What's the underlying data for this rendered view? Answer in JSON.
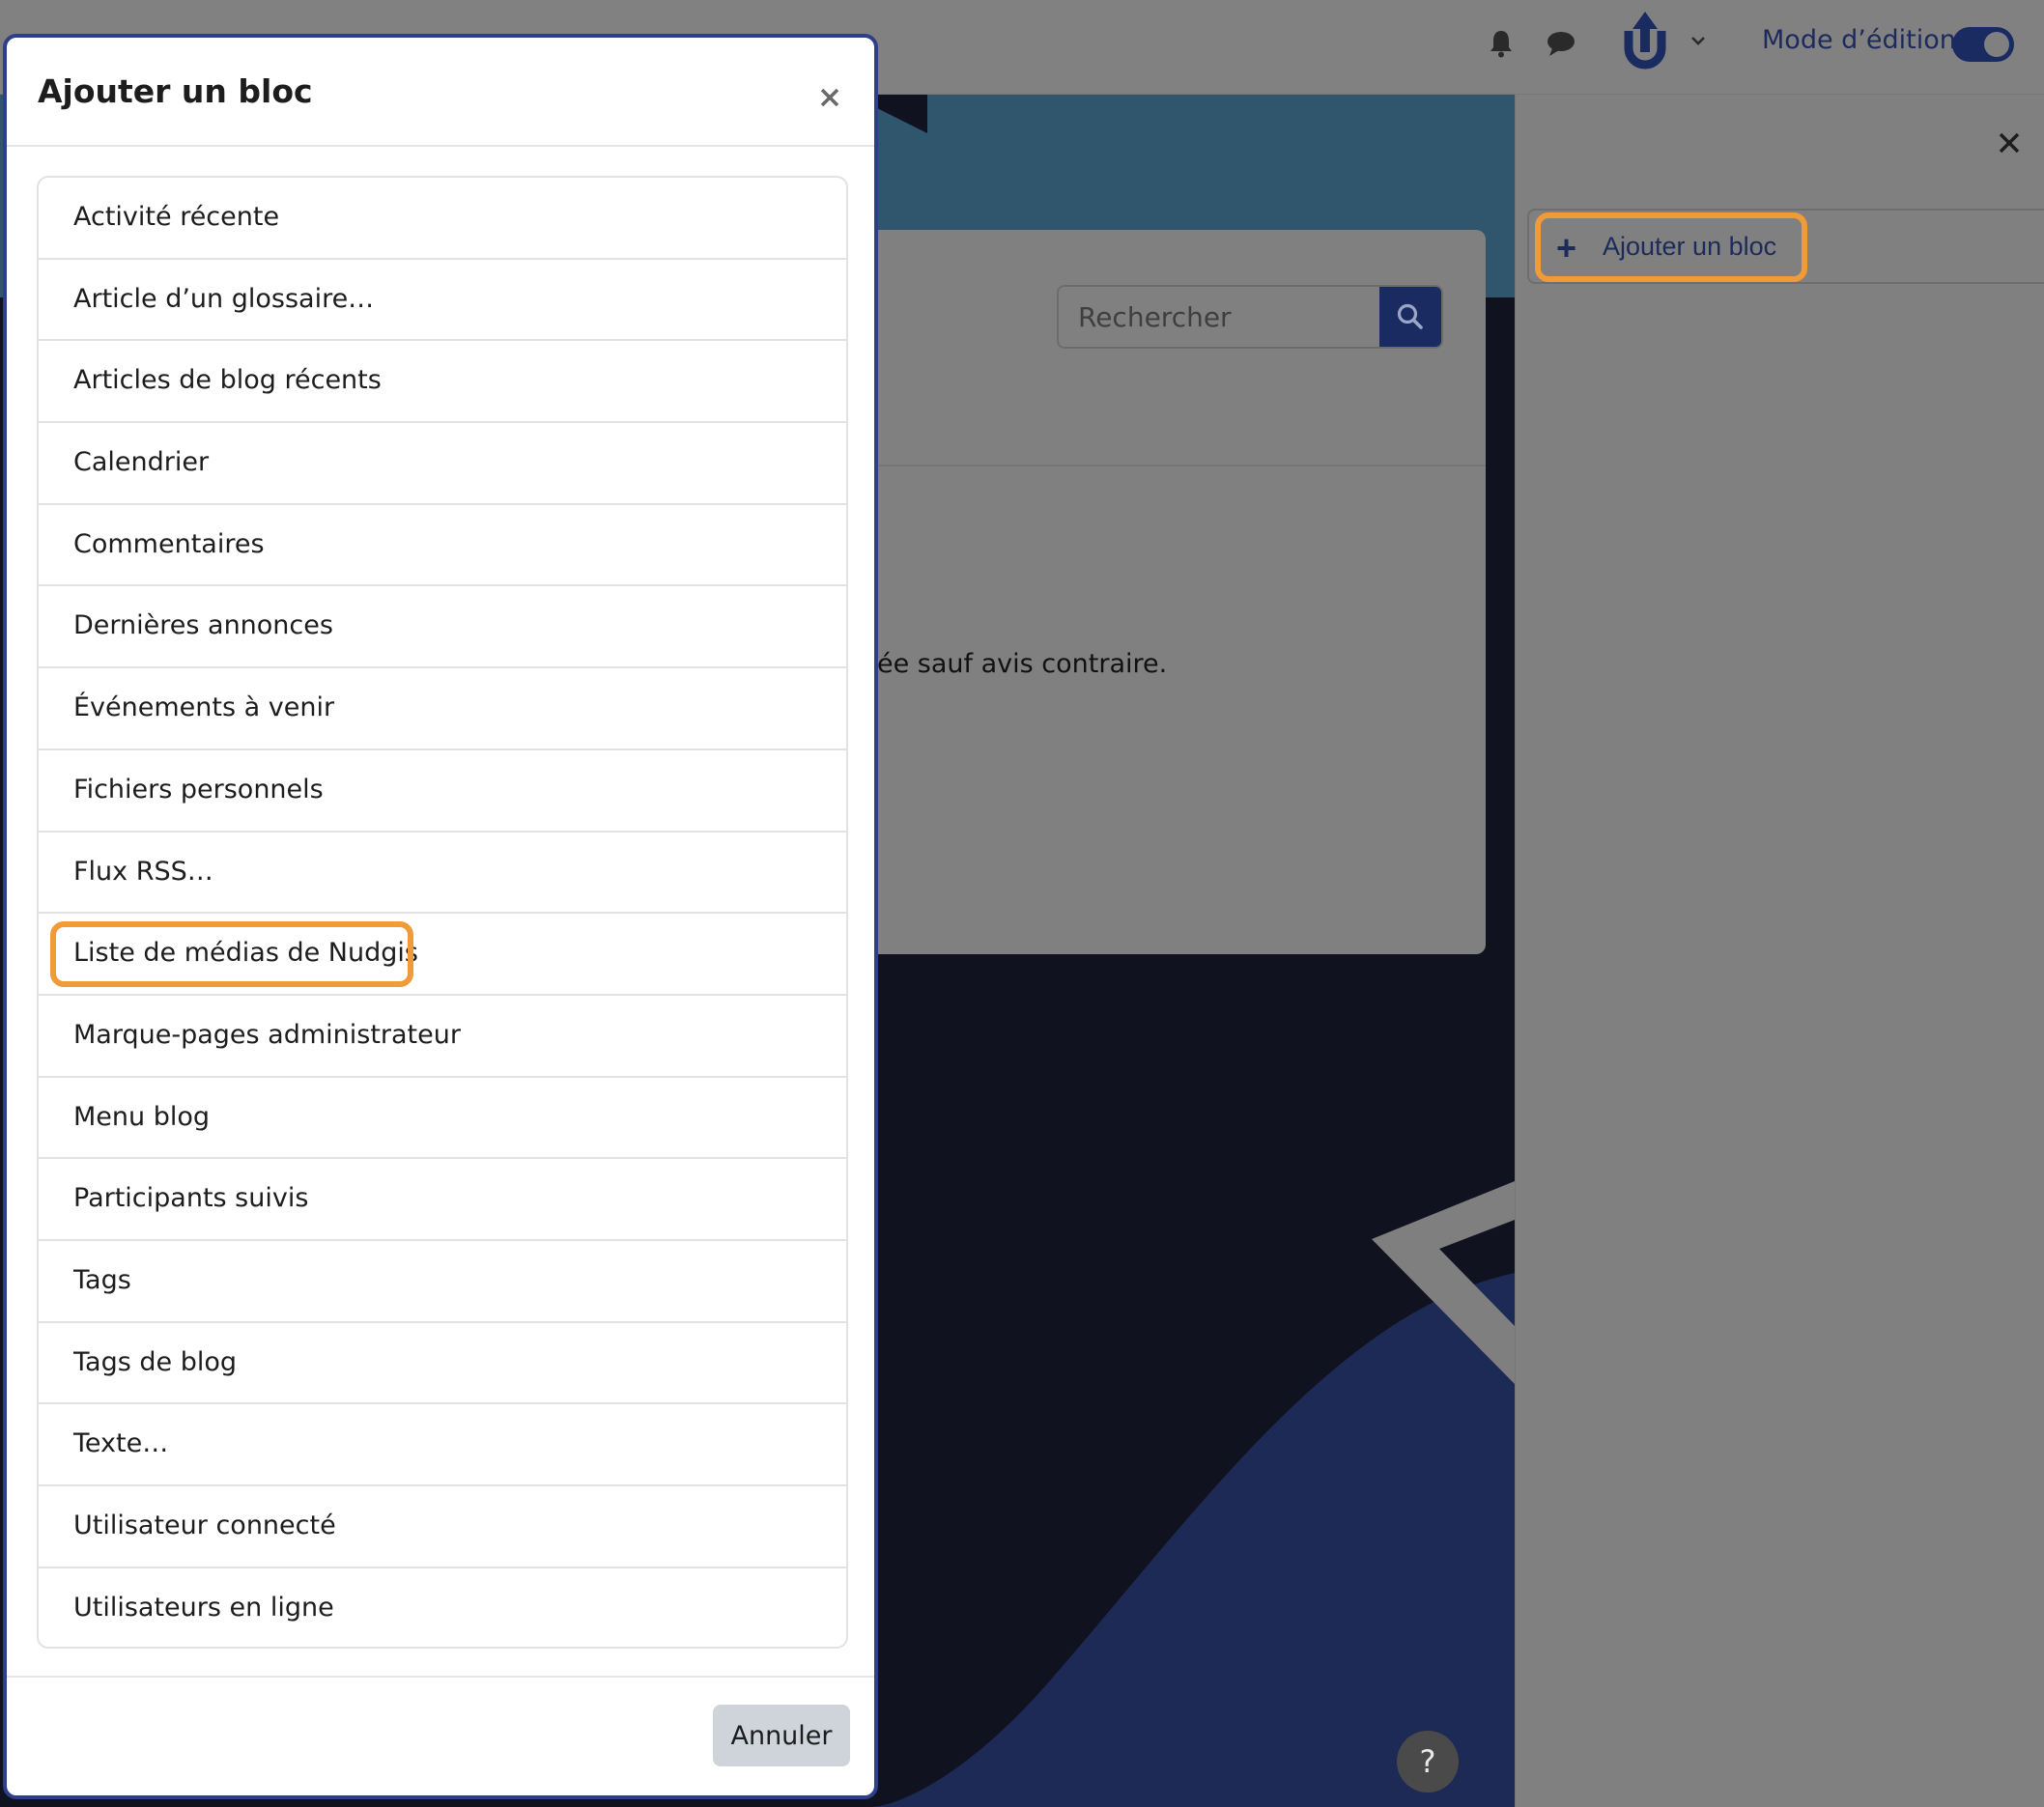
{
  "navbar": {
    "edit_mode_label": "Mode d’édition",
    "edit_mode_on": true,
    "icons": [
      "bell-icon",
      "chat-icon",
      "user-avatar",
      "chevron-down-icon"
    ]
  },
  "background_page": {
    "search_placeholder": "Rechercher",
    "partial_text": "ée sauf avis contraire."
  },
  "drawer": {
    "add_block_label": "Ajouter un bloc"
  },
  "modal": {
    "title": "Ajouter un bloc",
    "items": [
      {
        "label": "Activité récente"
      },
      {
        "label": "Article d’un glossaire…"
      },
      {
        "label": "Articles de blog récents"
      },
      {
        "label": "Calendrier"
      },
      {
        "label": "Commentaires"
      },
      {
        "label": "Dernières annonces"
      },
      {
        "label": "Événements à venir"
      },
      {
        "label": "Fichiers personnels"
      },
      {
        "label": "Flux RSS…"
      },
      {
        "label": "Liste de médias de Nudgis",
        "highlighted": true
      },
      {
        "label": "Marque-pages administrateur"
      },
      {
        "label": "Menu blog"
      },
      {
        "label": "Participants suivis"
      },
      {
        "label": "Tags"
      },
      {
        "label": "Tags de blog"
      },
      {
        "label": "Texte…"
      },
      {
        "label": "Utilisateur connecté"
      },
      {
        "label": "Utilisateurs en ligne"
      }
    ],
    "cancel_label": "Annuler"
  },
  "help_button_label": "?",
  "colors": {
    "accent": "#1a2b61",
    "highlight": "#f19a38",
    "modal_border": "#2d3e8a",
    "overlay": "#808080"
  }
}
